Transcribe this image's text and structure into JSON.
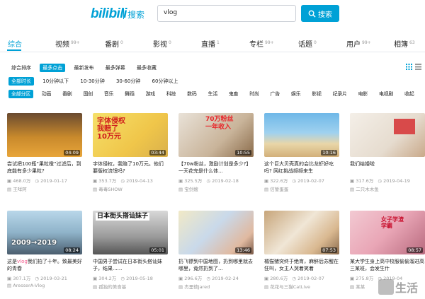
{
  "header": {
    "logo": "bilibili",
    "logo_sub": "搜索",
    "search_value": "vlog",
    "search_button": "搜索"
  },
  "tabs": [
    {
      "label": "综合",
      "count": ""
    },
    {
      "label": "视频",
      "count": "99+"
    },
    {
      "label": "番剧",
      "count": "0"
    },
    {
      "label": "影视",
      "count": "0"
    },
    {
      "label": "直播",
      "count": "1"
    },
    {
      "label": "专栏",
      "count": "99+"
    },
    {
      "label": "话题",
      "count": "0"
    },
    {
      "label": "用户",
      "count": "99+"
    },
    {
      "label": "相簿",
      "count": "63"
    }
  ],
  "sort_filters": [
    "综合排序",
    "最多点击",
    "最新发布",
    "最多弹幕",
    "最多收藏"
  ],
  "duration_filters": [
    "全部时长",
    "10分钟以下",
    "10-30分钟",
    "30-60分钟",
    "60分钟以上"
  ],
  "zone_filters": [
    "全部分区",
    "动画",
    "番剧",
    "国创",
    "音乐",
    "舞蹈",
    "游戏",
    "科技",
    "数码",
    "生活",
    "鬼畜",
    "时尚",
    "广告",
    "娱乐",
    "影视",
    "纪录片",
    "电影",
    "电视剧",
    "收起"
  ],
  "videos": [
    {
      "duration": "04:09",
      "title_pre": "尝试把100瓶“果粒橙”过滤后，到底能有多少果粒?",
      "title_hl": "",
      "title_post": "",
      "views": "468.0万",
      "date": "2019-01-17",
      "uploader": "王咩阿"
    },
    {
      "duration": "03:44",
      "overlay": "字体侵权\n我赔了\n10万元",
      "title_pre": "字体侵权，我赔了10万元。他们要版权流氓吗?",
      "title_hl": "",
      "title_post": "",
      "views": "353.7万",
      "date": "2019-04-13",
      "uploader": "毒毒SHOW"
    },
    {
      "duration": "10:55",
      "overlay": "70万粉丝\n一年收入",
      "title_pre": "【70w粉丝，激励计划是多少?】一天花完是什么体...",
      "title_hl": "",
      "title_post": "",
      "views": "325.5万",
      "date": "2019-02-18",
      "uploader": "宝剑嫂"
    },
    {
      "duration": "10:16",
      "title_pre": "这个巨大贝壳真的会比龙虾好吃吗? 网红挑战频频来生",
      "title_hl": "",
      "title_post": "",
      "views": "322.6万",
      "date": "2019-02-07",
      "uploader": "信誓蛋蛋"
    },
    {
      "duration": "",
      "title_pre": "我们结婚啦",
      "title_hl": "",
      "title_post": "",
      "views": "317.6万",
      "date": "2019-04-19",
      "uploader": "二只木木鱼"
    },
    {
      "duration": "08:24",
      "overlay": "2009→2019",
      "title_pre": "这是",
      "title_hl": "vlog",
      "title_post": "我们拍了十年。致最美好的青春",
      "views": "307.1万",
      "date": "2019-03-21",
      "uploader": "AresserA-Vlog"
    },
    {
      "duration": "05:01",
      "overlay": "日本街头搭讪妹子",
      "title_pre": "中国男子尝试在日本街头搭讪妹子，结果......",
      "title_hl": "",
      "title_post": "",
      "views": "304.2万",
      "date": "2019-05-18",
      "uploader": "孤独的美食基"
    },
    {
      "duration": "13:46",
      "title_pre": "扔飞镖到中国地图，扔到哪里就去哪里，竟然扔到了...",
      "title_hl": "",
      "title_post": "",
      "views": "296.6万",
      "date": "2019-02-24",
      "uploader": "杰里德Jared"
    },
    {
      "duration": "07:53",
      "title_pre": "橘猫猪突终于绝育，麻醉后苏醒在狂叫，女主人哭着笑着",
      "title_hl": "",
      "title_post": "",
      "views": "280.6万",
      "date": "2019-02-07",
      "uploader": "花花与三猫CatLive"
    },
    {
      "duration": "08:57",
      "overlay": "女子学渣\n学霸",
      "title_pre": "某大学生身上高中校服偷偷溜进高三某班，会发生什",
      "title_hl": "",
      "title_post": "",
      "views": "275.8万",
      "date": "2019-04",
      "uploader": "某某"
    }
  ],
  "watermark": "i生活"
}
